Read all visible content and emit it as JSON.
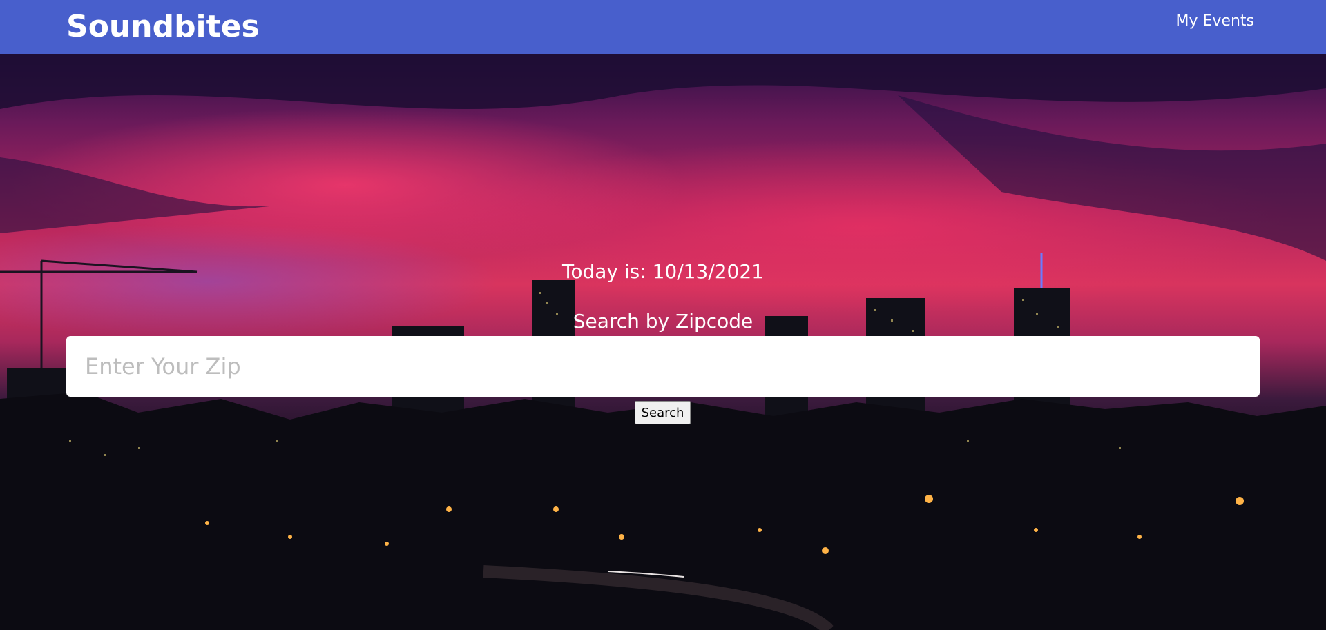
{
  "navbar": {
    "brand": "Soundbites",
    "link": "My Events",
    "color": "#485fcc"
  },
  "main": {
    "date_text": "Today is: 10/13/2021",
    "search_heading": "Search by Zipcode",
    "zip_placeholder": "Enter Your Zip",
    "zip_value": "",
    "search_button": "Search"
  }
}
